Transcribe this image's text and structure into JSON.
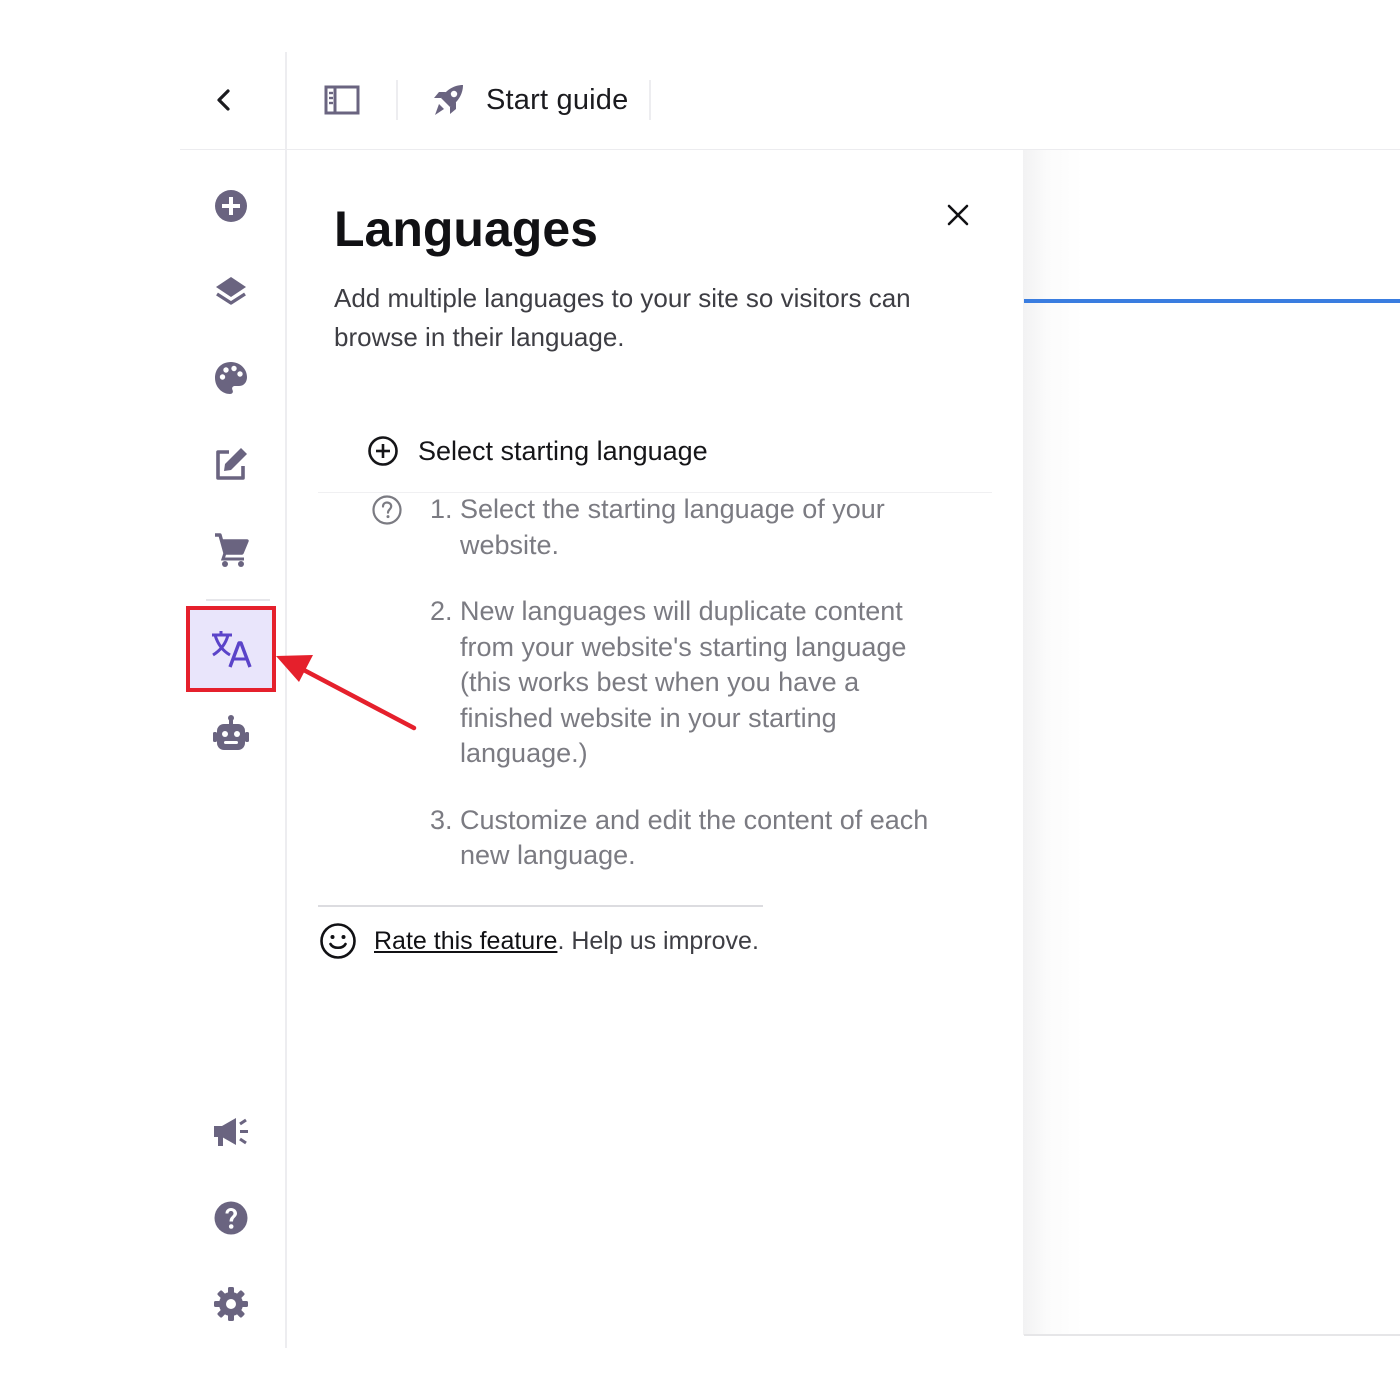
{
  "topbar": {
    "back_icon": "chevron-left-icon",
    "panel_toggle_icon": "sidebar-panel-icon",
    "start_guide_icon": "rocket-icon",
    "start_guide_label": "Start guide"
  },
  "rail": {
    "items": [
      {
        "name": "add",
        "icon": "plus-circle-icon"
      },
      {
        "name": "layers",
        "icon": "layers-icon"
      },
      {
        "name": "design",
        "icon": "palette-icon"
      },
      {
        "name": "edit",
        "icon": "edit-icon"
      },
      {
        "name": "store",
        "icon": "cart-icon"
      },
      {
        "name": "languages",
        "icon": "translate-icon",
        "active": true
      },
      {
        "name": "ai-assistant",
        "icon": "robot-icon"
      },
      {
        "name": "announcements",
        "icon": "megaphone-icon"
      },
      {
        "name": "help",
        "icon": "help-icon"
      },
      {
        "name": "settings",
        "icon": "gear-icon"
      }
    ],
    "icon_color": "#6a6480",
    "active_color": "#5b44c9",
    "active_bg": "#e9e5fb",
    "highlight_color": "#e5202c"
  },
  "panel": {
    "title": "Languages",
    "description": "Add multiple languages to your site so visitors can browse in their language.",
    "select_language_label": "Select starting language",
    "steps": [
      {
        "number": "1.",
        "text": "Select the starting language of your website."
      },
      {
        "number": "2.",
        "text": "New languages will duplicate content from your website's starting language (this works best when you have a finished website in your starting language.)"
      },
      {
        "number": "3.",
        "text": "Customize and edit the content of each new language."
      }
    ],
    "rate_link": "Rate this feature",
    "rate_suffix": ". Help us improve."
  },
  "colors": {
    "accent_blue": "#3a7de0",
    "arrow_red": "#e5202c"
  }
}
